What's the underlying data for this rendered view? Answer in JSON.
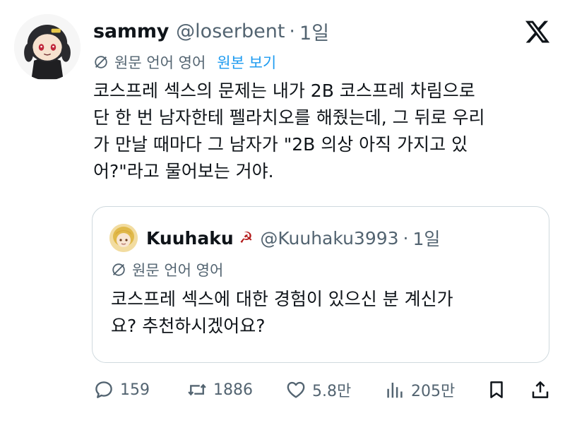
{
  "author": {
    "display_name": "sammy",
    "handle": "@loserbent",
    "separator": "·",
    "time": "1일"
  },
  "translation": {
    "label": "원문 언어 영어",
    "show_original": "원본 보기"
  },
  "tweet": {
    "lines": [
      "코스프레 섹스의 문제는 내가 2B 코스프레 차림으로",
      "단 한 번 남자한테 펠라치오를 해줬는데, 그 뒤로 우리",
      "가 만날 때마다 그 남자가 \"2B 의상 아직 가지고 있",
      "어?\"라고 물어보는 거야."
    ]
  },
  "quote": {
    "display_name": "Kuuhaku",
    "flag": "☭",
    "handle": "@Kuuhaku3993",
    "separator": "·",
    "time": "1일",
    "translation_label": "원문 언어 영어",
    "lines": [
      "코스프레 섹스에 대한 경험이 있으신 분 계신가",
      "요? 추천하시겠어요?"
    ]
  },
  "actions": {
    "replies": "159",
    "retweets": "1886",
    "likes": "5.8만",
    "views": "205만"
  },
  "icons": {
    "logo": "x-logo-icon",
    "translate": "globe-off-icon",
    "reply": "reply-icon",
    "retweet": "retweet-icon",
    "like": "heart-icon",
    "views": "views-icon",
    "bookmark": "bookmark-icon",
    "share": "share-icon"
  },
  "colors": {
    "text": "#0f1419",
    "secondary": "#536471",
    "link": "#1d9bf0",
    "border": "#cfd9de"
  }
}
